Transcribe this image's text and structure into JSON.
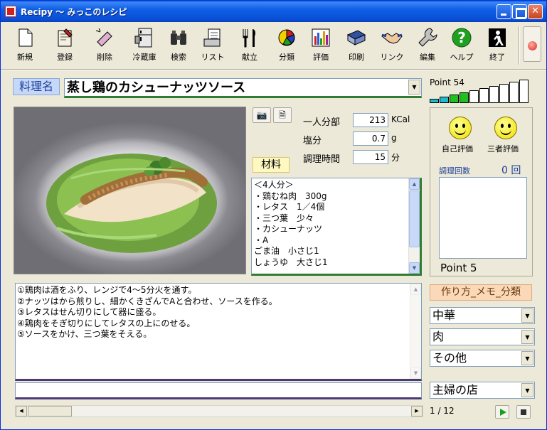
{
  "window": {
    "title": "Recipy 〜 みっこのレシピ"
  },
  "toolbar": {
    "items": [
      {
        "label": "新規",
        "icon": "new-document-icon"
      },
      {
        "label": "登録",
        "icon": "register-icon"
      },
      {
        "label": "削除",
        "icon": "delete-icon"
      },
      {
        "label": "冷蔵庫",
        "icon": "refrigerator-icon"
      },
      {
        "label": "検索",
        "icon": "binoculars-icon"
      },
      {
        "label": "リスト",
        "icon": "list-icon"
      },
      {
        "label": "献立",
        "icon": "utensils-icon"
      },
      {
        "label": "分類",
        "icon": "pie-chart-icon"
      },
      {
        "label": "評価",
        "icon": "bar-chart-icon"
      },
      {
        "label": "印刷",
        "icon": "printer-icon"
      },
      {
        "label": "リンク",
        "icon": "handshake-icon"
      },
      {
        "label": "編集",
        "icon": "wrench-icon"
      },
      {
        "label": "ヘルプ",
        "icon": "help-icon"
      },
      {
        "label": "終了",
        "icon": "exit-icon"
      }
    ]
  },
  "recipe": {
    "name_label": "料理名",
    "name": "蒸し鶏のカシューナッツソース"
  },
  "points": {
    "top_label": "Point 54",
    "level_fraction": 0.4,
    "bottom_label": "Point 5"
  },
  "nutrition": {
    "rows": [
      {
        "label": "一人分部",
        "value": "213",
        "unit": "KCal"
      },
      {
        "label": "塩分",
        "value": "0.7",
        "unit": "g"
      },
      {
        "label": "調理時間",
        "value": "15",
        "unit": "分"
      }
    ]
  },
  "materials": {
    "label": "材料",
    "lines": [
      "＜4人分＞",
      "・鶏むね肉　300g",
      "・レタス　1／4個",
      "・三つ葉　少々",
      "・カシューナッツ",
      "・A",
      "ごま油　小さじ1",
      "しょうゆ　大さじ1"
    ]
  },
  "rating": {
    "self_label": "自己評価",
    "other_label": "三者評価",
    "cook_count_label": "調理回数",
    "cook_count_value": "0 回"
  },
  "instructions": {
    "lines": [
      "①鶏肉は酒をふり、レンジで4〜5分火を通す。",
      "②ナッツはから煎りし、細かくきざんでAと合わせ、ソースを作る。",
      "③レタスはせん切りにして器に盛る。",
      "④鶏肉をそぎ切りにしてレタスの上にのせる。",
      "⑤ソースをかけ、三つ葉をそえる。"
    ],
    "memo": ""
  },
  "category": {
    "label": "作り方_メモ_分類",
    "values": [
      "中華",
      "肉",
      "その他"
    ],
    "store": "主婦の店"
  },
  "pager": {
    "indicator": "1 / 12"
  },
  "colors": {
    "title_bar": "#0A4FD6",
    "name_underline": "#2E7D32",
    "instr_underline": "#4B3A7A",
    "point_bar": "#20C020"
  }
}
